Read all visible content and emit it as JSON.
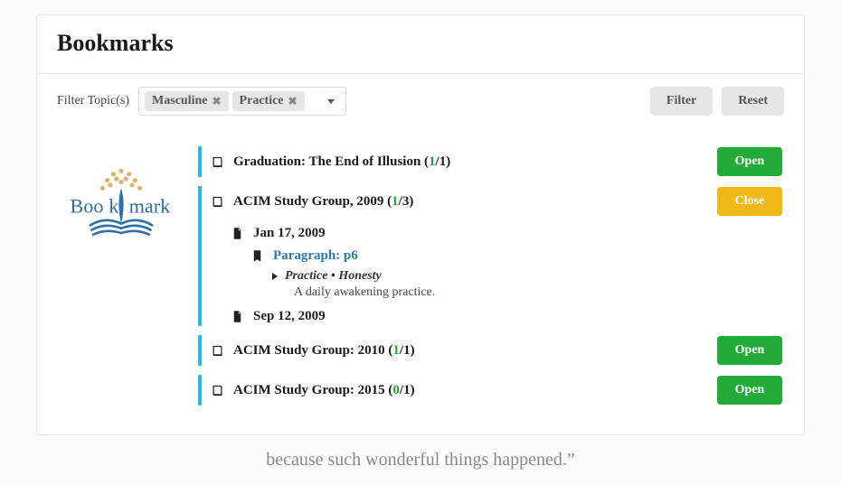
{
  "header": {
    "title": "Bookmarks"
  },
  "filter": {
    "label": "Filter Topic(s)",
    "tags": [
      "Masculine",
      "Practice"
    ],
    "filter_btn": "Filter",
    "reset_btn": "Reset"
  },
  "open_label": "Open",
  "close_label": "Close",
  "entries": [
    {
      "title": "Graduation: The End of Illusion",
      "shown": "1",
      "total": "1",
      "action": "open"
    },
    {
      "title": "ACIM Study Group, 2009",
      "shown": "1",
      "total": "3",
      "action": "close",
      "dates": [
        {
          "label": "Jan 17, 2009",
          "paragraph": "Paragraph: p6",
          "topics": "Practice  •  Honesty",
          "note": "A daily awakening practice."
        },
        {
          "label": "Sep 12, 2009"
        }
      ]
    },
    {
      "title": "ACIM Study Group: 2010",
      "shown": "1",
      "total": "1",
      "action": "open"
    },
    {
      "title": "ACIM Study Group: 2015",
      "shown": "0",
      "total": "1",
      "action": "open"
    }
  ],
  "footer": "because such wonderful things happened.”"
}
